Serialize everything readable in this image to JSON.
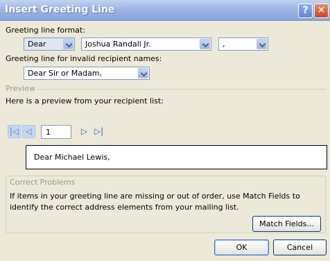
{
  "window": {
    "title": "Insert Greeting Line",
    "help_glyph": "?",
    "close_glyph": "✕"
  },
  "greeting_format": {
    "label": "Greeting line format:",
    "salutation": "Dear",
    "name_format": "Joshua Randall Jr.",
    "punctuation": ","
  },
  "invalid": {
    "label": "Greeting line for invalid recipient names:",
    "value": "Dear Sir or Madam,"
  },
  "preview": {
    "group_title": "Preview",
    "label": "Here is a preview from your recipient list:",
    "record_number": "1",
    "nav": {
      "first": "|◁",
      "prev": "◁",
      "next": "▷",
      "last": "▷|"
    },
    "text": "Dear Michael Lewis,"
  },
  "correct": {
    "group_title": "Correct Problems",
    "line1": "If items in your greeting line are missing or out of order, use Match Fields to",
    "line2": "identify the correct address elements from your mailing list.",
    "match_fields_button": "Match Fields..."
  },
  "buttons": {
    "ok": "OK",
    "cancel": "Cancel"
  }
}
